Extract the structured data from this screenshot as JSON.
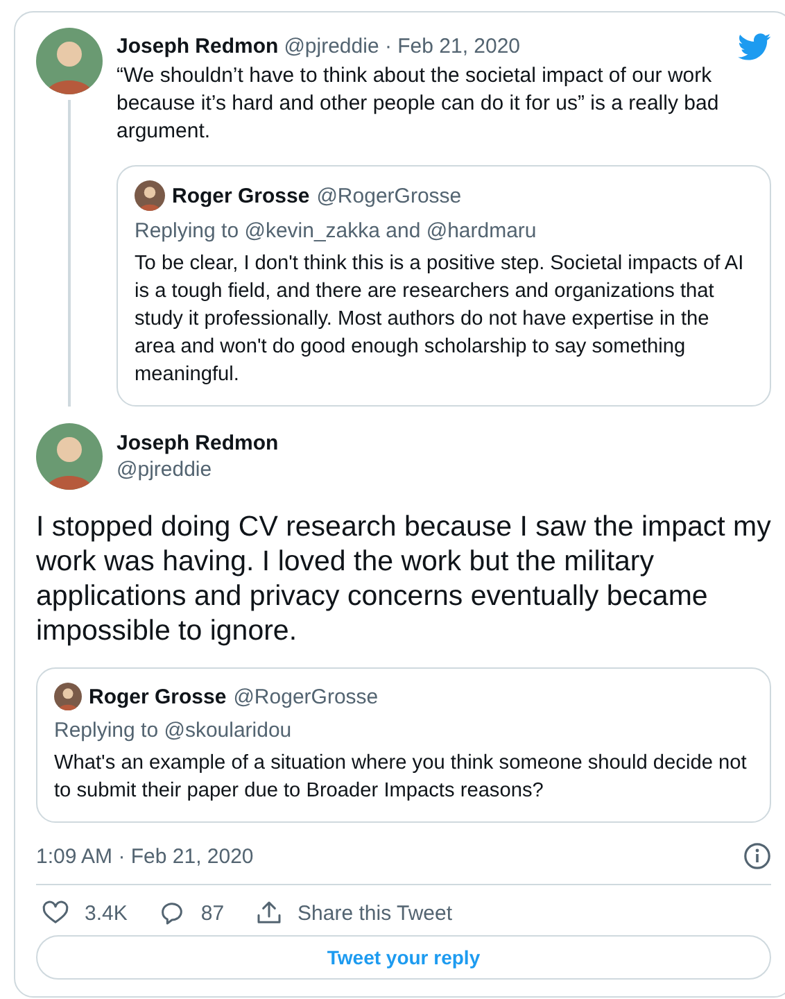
{
  "parent_tweet": {
    "name": "Joseph Redmon",
    "meta": "@pjreddie · Feb 21, 2020",
    "text": "“We shouldn’t have to think about the societal impact of our work because it’s hard and other people can do it for us” is a really bad argument.",
    "quoted": {
      "name": "Roger Grosse",
      "handle": "@RogerGrosse",
      "replying_to": "Replying to @kevin_zakka and @hardmaru",
      "text": "To be clear, I don't think this is a positive step. Societal impacts of AI is a tough field, and there are researchers and organizations that study it professionally. Most authors do not have expertise in the area and won't do good enough scholarship to say something meaningful."
    }
  },
  "main_tweet": {
    "name": "Joseph Redmon",
    "handle": "@pjreddie",
    "text": "I stopped doing CV research because I saw the impact my work was having. I loved the work but the military applications and privacy concerns eventually became impossible to ignore.",
    "quoted": {
      "name": "Roger Grosse",
      "handle": "@RogerGrosse",
      "replying_to": "Replying to @skoularidou",
      "text": "What's an example of a situation where you think someone should decide not to submit their paper due to Broader Impacts reasons?"
    },
    "timestamp": "1:09 AM · Feb 21, 2020"
  },
  "actions": [
    {
      "kind": "like",
      "label": "3.4K"
    },
    {
      "kind": "reply",
      "label": "87"
    },
    {
      "kind": "share",
      "label": "Share this Tweet"
    }
  ],
  "reply_button": "Tweet your reply"
}
